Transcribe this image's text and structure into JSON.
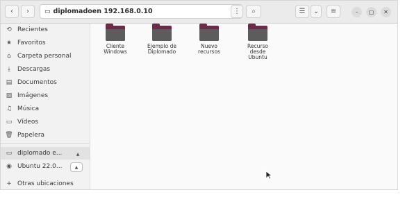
{
  "header": {
    "back": "‹",
    "forward": "›",
    "path_host": "diplomado",
    "path_rest": " en 192.168.0.10",
    "menu": "⋮",
    "search": "⌕",
    "view_list": "☰",
    "view_toggle": "⌄",
    "main_menu": "≡",
    "minimize": "–",
    "maximize": "▢",
    "close": "✕"
  },
  "sidebar": {
    "items": [
      {
        "label": "Recientes",
        "icon": "⟲"
      },
      {
        "label": "Favoritos",
        "icon": "★"
      },
      {
        "label": "Carpeta personal",
        "icon": "⌂"
      },
      {
        "label": "Descargas",
        "icon": "⤓"
      },
      {
        "label": "Documentos",
        "icon": "▤"
      },
      {
        "label": "Imágenes",
        "icon": "▨"
      },
      {
        "label": "Música",
        "icon": "♫"
      },
      {
        "label": "Vídeos",
        "icon": "▭"
      },
      {
        "label": "Papelera",
        "icon": "🗑"
      }
    ],
    "mounts": [
      {
        "label": "diplomado e...",
        "icon": "▭",
        "eject": "▲"
      },
      {
        "label": "Ubuntu 22.0...",
        "icon": "◉",
        "eject": "▲"
      }
    ],
    "other": {
      "label": "Otras ubicaciones",
      "icon": "+"
    }
  },
  "files": [
    {
      "name": "Cliente\nWindows"
    },
    {
      "name": "Ejemplo de\nDiplomado"
    },
    {
      "name": "Nuevo\nrecursos"
    },
    {
      "name": "Recurso\ndesde\nUbuntu"
    }
  ]
}
